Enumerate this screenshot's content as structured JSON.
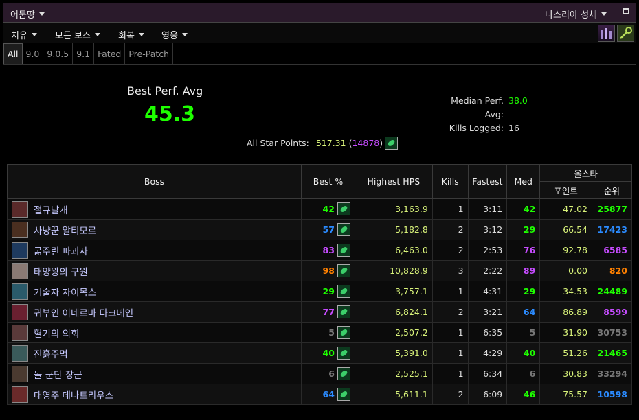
{
  "header": {
    "zone": "어둠땅",
    "raid": "나스리아 성채"
  },
  "menu": {
    "items": [
      "치유",
      "모든 보스",
      "회복",
      "영웅"
    ]
  },
  "tabs": [
    "All",
    "9.0",
    "9.0.5",
    "9.1",
    "Fated",
    "Pre-Patch"
  ],
  "summary": {
    "best_label": "Best Perf. Avg",
    "best_value": "45.3",
    "median_label": "Median Perf. Avg:",
    "median_value": "38.0",
    "kills_label": "Kills Logged:",
    "kills_value": "16",
    "star_label": "All Star Points:",
    "star_points": "517.31",
    "star_rank": "14878"
  },
  "table": {
    "headers": {
      "boss": "Boss",
      "best": "Best %",
      "hps": "Highest HPS",
      "kills": "Kills",
      "fastest": "Fastest",
      "med": "Med",
      "allstar": "올스타",
      "points": "포인트",
      "rank": "순위"
    },
    "rows": [
      {
        "boss": "절규날개",
        "best": "42",
        "best_c": "g",
        "hps": "3,163.9",
        "kills": "1",
        "fastest": "3:11",
        "med": "42",
        "med_c": "g",
        "points": "47.02",
        "rank": "25877",
        "rank_c": "g",
        "icon": "#5a2a2a"
      },
      {
        "boss": "사냥꾼 알티모르",
        "best": "57",
        "best_c": "b",
        "hps": "5,182.8",
        "kills": "2",
        "fastest": "3:12",
        "med": "29",
        "med_c": "g",
        "points": "66.54",
        "rank": "17423",
        "rank_c": "b",
        "icon": "#4a2f20"
      },
      {
        "boss": "굶주린 파괴자",
        "best": "83",
        "best_c": "p",
        "hps": "6,463.0",
        "kills": "2",
        "fastest": "2:53",
        "med": "76",
        "med_c": "p",
        "points": "92.78",
        "rank": "6585",
        "rank_c": "p",
        "icon": "#1e3a5e"
      },
      {
        "boss": "태양왕의 구원",
        "best": "98",
        "best_c": "o",
        "hps": "10,828.9",
        "kills": "3",
        "fastest": "2:22",
        "med": "89",
        "med_c": "p",
        "points": "0.00",
        "rank": "820",
        "rank_c": "o",
        "icon": "#8a7a74"
      },
      {
        "boss": "기술자 자이목스",
        "best": "29",
        "best_c": "g",
        "hps": "3,757.1",
        "kills": "1",
        "fastest": "4:31",
        "med": "29",
        "med_c": "g",
        "points": "34.53",
        "rank": "24489",
        "rank_c": "g",
        "icon": "#2a5a6a"
      },
      {
        "boss": "귀부인 이네르바 다크베인",
        "best": "77",
        "best_c": "p",
        "hps": "6,824.1",
        "kills": "2",
        "fastest": "3:21",
        "med": "64",
        "med_c": "b",
        "points": "86.89",
        "rank": "8599",
        "rank_c": "p",
        "icon": "#6a2030"
      },
      {
        "boss": "혈기의 의회",
        "best": "5",
        "best_c": "gr",
        "hps": "2,507.2",
        "kills": "1",
        "fastest": "6:35",
        "med": "5",
        "med_c": "gr",
        "points": "31.90",
        "rank": "30753",
        "rank_c": "gr",
        "icon": "#5a3a3a"
      },
      {
        "boss": "진흙주먹",
        "best": "40",
        "best_c": "g",
        "hps": "5,391.0",
        "kills": "1",
        "fastest": "4:29",
        "med": "40",
        "med_c": "g",
        "points": "51.26",
        "rank": "21465",
        "rank_c": "g",
        "icon": "#3a5a5a"
      },
      {
        "boss": "돌 군단 장군",
        "best": "6",
        "best_c": "gr",
        "hps": "2,525.1",
        "kills": "1",
        "fastest": "6:34",
        "med": "6",
        "med_c": "gr",
        "points": "30.83",
        "rank": "33294",
        "rank_c": "gr",
        "icon": "#4a3a30"
      },
      {
        "boss": "대영주 데나트리우스",
        "best": "64",
        "best_c": "b",
        "hps": "5,611.1",
        "kills": "2",
        "fastest": "6:09",
        "med": "46",
        "med_c": "g",
        "points": "75.57",
        "rank": "10598",
        "rank_c": "b",
        "icon": "#6a2a2a"
      }
    ]
  }
}
